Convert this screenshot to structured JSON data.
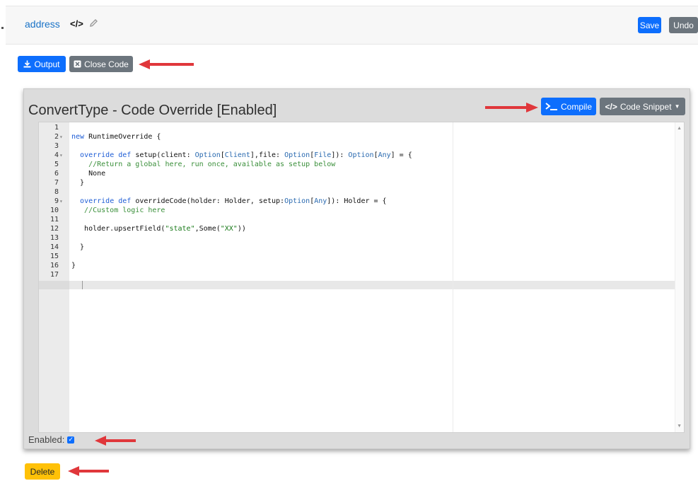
{
  "header": {
    "field_name": "address",
    "code_icon": "code-icon",
    "edit_icon": "pencil-icon",
    "save_label": "Save",
    "undo_label": "Undo"
  },
  "toolbar": {
    "output_label": "Output",
    "output_icon": "download-icon",
    "close_code_label": "Close Code",
    "close_code_icon": "close-box-icon"
  },
  "panel": {
    "title": "ConvertType - Code Override [Enabled]",
    "compile_label": "Compile",
    "compile_icon": "terminal-icon",
    "snippet_label": "Code Snippet",
    "snippet_icon": "code-icon",
    "enabled_label": "Enabled:",
    "enabled_checked": true
  },
  "editor": {
    "lines": [
      {
        "n": "1",
        "text": ""
      },
      {
        "n": "2",
        "text": "new RuntimeOverride {"
      },
      {
        "n": "3",
        "text": ""
      },
      {
        "n": "4",
        "text": "  override def setup(client: Option[Client],file: Option[File]): Option[Any] = {"
      },
      {
        "n": "5",
        "text": "    //Return a global here, run once, available as setup below"
      },
      {
        "n": "6",
        "text": "    None"
      },
      {
        "n": "7",
        "text": "  }"
      },
      {
        "n": "8",
        "text": ""
      },
      {
        "n": "9",
        "text": "  override def overrideCode(holder: Holder, setup:Option[Any]): Holder = {"
      },
      {
        "n": "10",
        "text": "   //Custom logic here"
      },
      {
        "n": "11",
        "text": ""
      },
      {
        "n": "12",
        "text": "   holder.upsertField(\"state\",Some(\"XX\"))"
      },
      {
        "n": "13",
        "text": ""
      },
      {
        "n": "14",
        "text": "  }"
      },
      {
        "n": "15",
        "text": ""
      },
      {
        "n": "16",
        "text": "}"
      },
      {
        "n": "17",
        "text": ""
      }
    ]
  },
  "footer": {
    "delete_label": "Delete"
  },
  "colors": {
    "primary": "#0d6efd",
    "secondary": "#6c757d",
    "warning": "#ffc107",
    "annotation_arrow": "#e0373b"
  }
}
